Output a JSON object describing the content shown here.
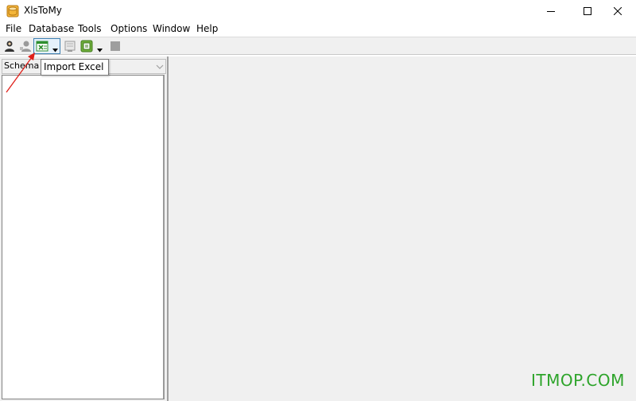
{
  "window": {
    "title": "XlsToMy",
    "icon": "database-cylinder-icon"
  },
  "menu": [
    "File",
    "Database",
    "Tools",
    "Options",
    "Window",
    "Help"
  ],
  "toolbar": {
    "buttons": [
      "connect-user-icon",
      "disconnect-icon",
      "import-excel-icon",
      "export-icon",
      "run-icon",
      "stop-icon"
    ],
    "tooltip": "Import Excel"
  },
  "schema_panel": {
    "tab_label": "Schema"
  },
  "watermark": "ITMOP.COM",
  "colors": {
    "annotation_arrow": "#e0201a",
    "watermark": "#2da42a",
    "excel_icon": "#2f8f2f"
  }
}
